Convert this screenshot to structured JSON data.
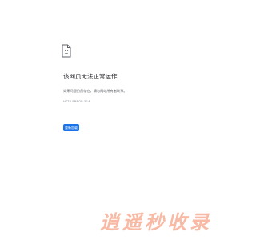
{
  "error": {
    "icon": "broken-page-icon",
    "title": "该网页无法正常运作",
    "description": "如果问题仍然存在，请与网站所有者联系。",
    "code": "HTTP ERROR 514",
    "reload_label": "重新加载"
  },
  "watermark": {
    "text": "逍遥秒收录",
    "color": "#f7b39a"
  },
  "colors": {
    "button": "#1a73e8",
    "title": "#202124",
    "description": "#5f6368",
    "code": "#80868b"
  }
}
